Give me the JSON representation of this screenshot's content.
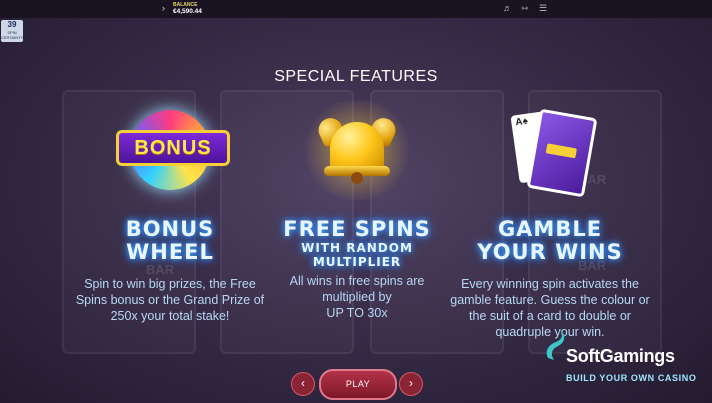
{
  "topbar": {
    "balance_label": "BALANCE",
    "balance_value": "€4,590.44",
    "arrow_icon": "chevron-right-icon",
    "icons": [
      "sound-icon",
      "fullscreen-icon",
      "menu-icon"
    ]
  },
  "badge": {
    "number": "39",
    "text": "SPIN CERTAINTY"
  },
  "title": "SPECIAL FEATURES",
  "features": [
    {
      "image_text": "BONUS",
      "heading_line1": "BONUS",
      "heading_line2": "WHEEL",
      "description": "Spin to win big prizes, the Free Spins bonus or the Grand Prize of 250x your total stake!"
    },
    {
      "heading_line1": "FREE SPINS",
      "heading_line2": "WITH RANDOM",
      "heading_line3": "MULTIPLIER",
      "description": "All wins in free spins are multiplied by",
      "description_line2": "UP TO 30x"
    },
    {
      "heading_line1": "GAMBLE",
      "heading_line2": "YOUR WINS",
      "description": "Every winning spin activates the gamble feature. Guess the colour or the suit of a card to double or quadruple your win."
    }
  ],
  "controls": {
    "play_label": "PLAY",
    "prev_icon": "chevron-left-icon",
    "next_icon": "chevron-right-icon"
  },
  "watermark": {
    "name": "SoftGamings",
    "tagline": "BUILD YOUR OWN CASINO"
  },
  "colors": {
    "background": "#382c48",
    "heading_glow": "#38a7ff",
    "button": "#9a2236",
    "description": "#b7d8f5"
  }
}
